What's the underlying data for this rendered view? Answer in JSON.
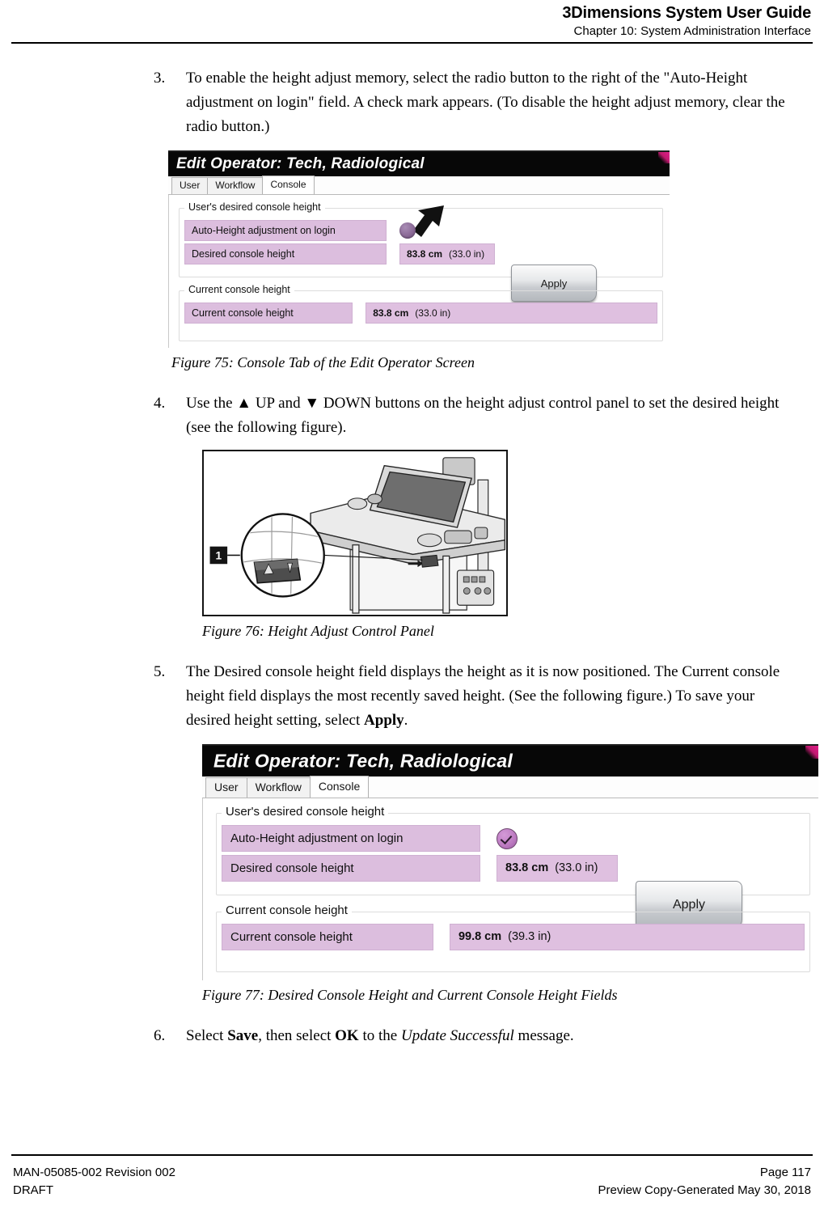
{
  "header": {
    "title": "3Dimensions System User Guide",
    "subtitle": "Chapter 10: System Administration Interface"
  },
  "steps": [
    {
      "number": "3.",
      "text": "To enable the height adjust memory, select the radio button to the right of the \"Auto-Height adjustment on login\" field. A check mark appears. (To disable the height adjust memory, clear the radio button.)"
    },
    {
      "number": "4.",
      "text": "Use the ▲ UP and ▼ DOWN buttons on the height adjust control panel to set the desired height (see the following figure)."
    },
    {
      "number": "5.",
      "text_before_bold": "The Desired console height field displays the height as it is now positioned. The Current console height field displays the most recently saved height. (See the following figure.) To save your desired height setting, select ",
      "bold": "Apply",
      "text_after_bold": "."
    },
    {
      "number": "6.",
      "seg1": "Select ",
      "bold1": "Save",
      "seg2": ", then select ",
      "bold2": "OK",
      "seg3": " to the ",
      "italic1": "Update Successful",
      "seg4": " message."
    }
  ],
  "figure75": {
    "caption": "Figure 75: Console Tab of the Edit Operator Screen",
    "titlebar": "Edit Operator: Tech, Radiological",
    "tabs": [
      {
        "label": "User",
        "active": false
      },
      {
        "label": "Workflow",
        "active": false
      },
      {
        "label": "Console",
        "active": true
      }
    ],
    "group1_legend": "User's desired console height",
    "group2_legend": "Current console height",
    "rows": [
      {
        "label": "Auto-Height adjustment on login",
        "control": "radio-unchecked"
      },
      {
        "label": "Desired console height",
        "value_cm": "83.8 cm",
        "value_in": "(33.0 in)"
      }
    ],
    "current_row": {
      "label": "Current console height",
      "value_cm": "83.8 cm",
      "value_in": "(33.0 in)"
    },
    "apply_label": "Apply",
    "annotation": "callout-arrow-to-radio-button"
  },
  "figure76": {
    "caption": "Figure 76: Height Adjust Control Panel",
    "callout_number": "1",
    "alt": "Line drawing of the acquisition workstation console with a magnified detail circle showing the height adjust control panel containing UP and DOWN arrow buttons."
  },
  "figure77": {
    "caption": "Figure 77: Desired Console Height and Current Console Height Fields",
    "titlebar": "Edit Operator: Tech, Radiological",
    "tabs": [
      {
        "label": "User",
        "active": false
      },
      {
        "label": "Workflow",
        "active": false
      },
      {
        "label": "Console",
        "active": true
      }
    ],
    "group1_legend": "User's desired console height",
    "group2_legend": "Current console height",
    "rows": [
      {
        "label": "Auto-Height adjustment on login",
        "control": "radio-checked"
      },
      {
        "label": "Desired console height",
        "value_cm": "83.8 cm",
        "value_in": "(33.0 in)"
      }
    ],
    "current_row": {
      "label": "Current console height",
      "value_cm": "99.8 cm",
      "value_in": "(39.3 in)"
    },
    "apply_label": "Apply"
  },
  "footer": {
    "left_top": "MAN-05085-002 Revision 002",
    "left_bottom": "DRAFT",
    "right_top": "Page 117",
    "right_bottom": "Preview Copy-Generated May 30, 2018"
  },
  "colors": {
    "field_label_bg": "#dcbede",
    "field_value_bg": "#dfc0e0",
    "titlebar_bg": "#070707",
    "accent_magenta": "#e0208a",
    "radio_purple": "#8b6a97"
  }
}
